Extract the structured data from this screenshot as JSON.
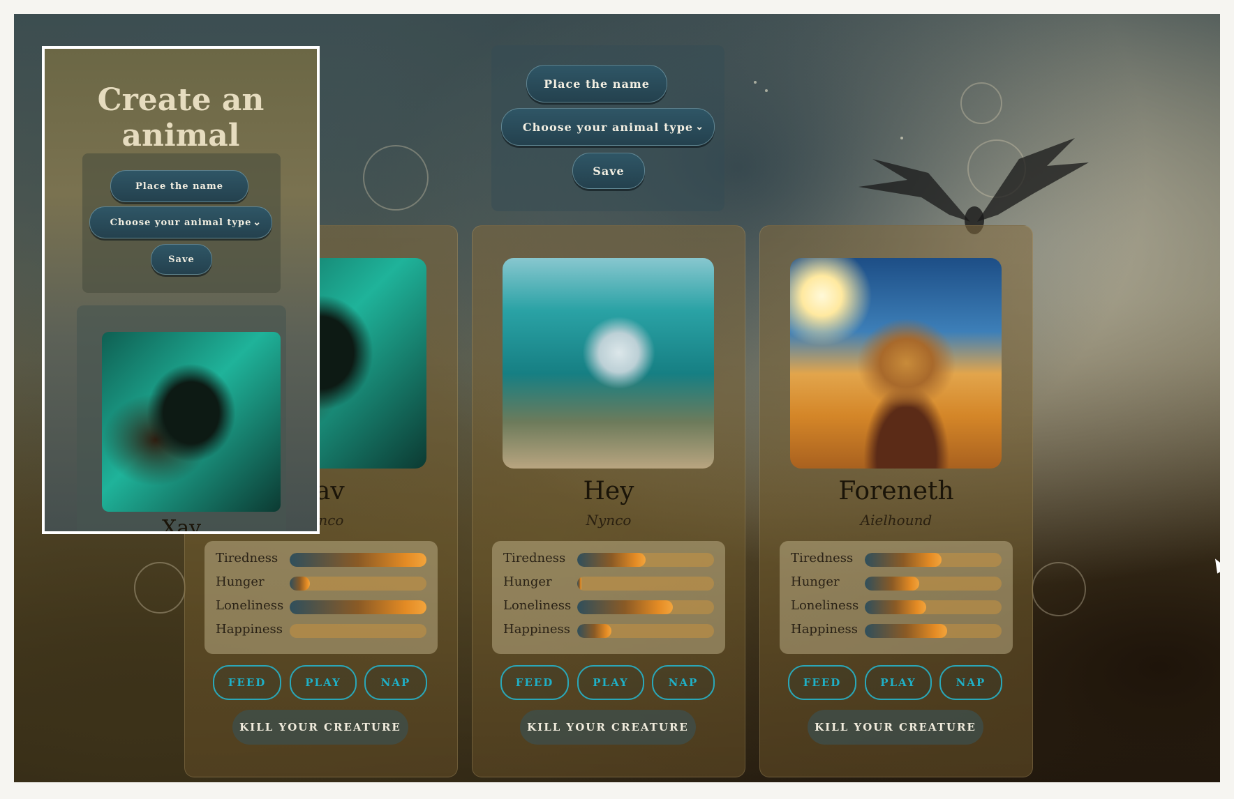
{
  "create_form": {
    "name_placeholder": "Place the name",
    "type_placeholder": "Choose your animal type",
    "save_label": "Save"
  },
  "overlay": {
    "title": "Create an animal",
    "name_placeholder": "Place the name",
    "type_placeholder": "Choose your animal type",
    "save_label": "Save",
    "preview_name": "Xav"
  },
  "stat_labels": [
    "Tiredness",
    "Hunger",
    "Loneliness",
    "Happiness"
  ],
  "cards": [
    {
      "name": "Xav",
      "type": "Nynco",
      "stats": {
        "Tiredness": 100,
        "Hunger": 15,
        "Loneliness": 100,
        "Happiness": 0
      },
      "buttons": {
        "feed": "FEED",
        "play": "PLAY",
        "nap": "NAP",
        "kill": "KILL YOUR CREATURE"
      }
    },
    {
      "name": "Hey",
      "type": "Nynco",
      "stats": {
        "Tiredness": 50,
        "Hunger": 3,
        "Loneliness": 70,
        "Happiness": 25
      },
      "buttons": {
        "feed": "FEED",
        "play": "PLAY",
        "nap": "NAP",
        "kill": "KILL YOUR CREATURE"
      }
    },
    {
      "name": "Foreneth",
      "type": "Aielhound",
      "stats": {
        "Tiredness": 56,
        "Hunger": 40,
        "Loneliness": 45,
        "Happiness": 60
      },
      "buttons": {
        "feed": "FEED",
        "play": "PLAY",
        "nap": "NAP",
        "kill": "KILL YOUR CREATURE"
      }
    }
  ],
  "colors": {
    "accent_teal": "#1fb0c7",
    "bar_orange": "#e48b24",
    "pill_blue": "#2f5666"
  }
}
